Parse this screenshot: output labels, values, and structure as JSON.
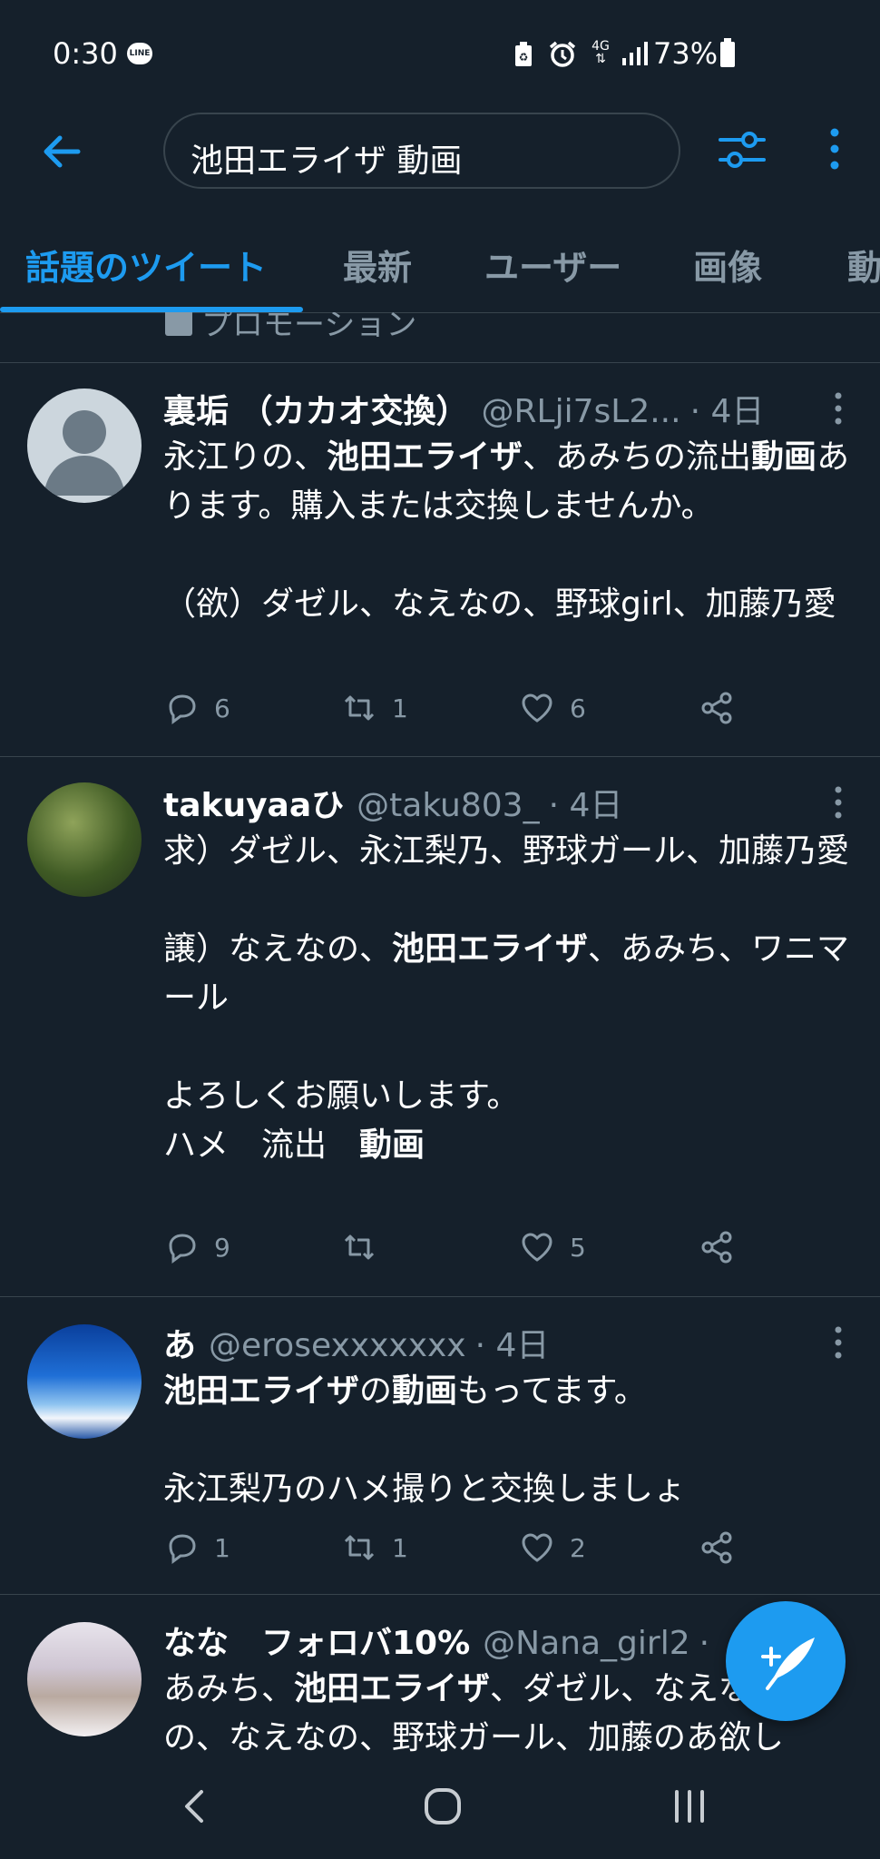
{
  "status": {
    "time": "0:30",
    "line_badge": "LINE",
    "network": "4G",
    "battery": "73%"
  },
  "header": {
    "search_query": "池田エライザ 動画"
  },
  "tabs": [
    "話題のツイート",
    "最新",
    "ユーザー",
    "画像",
    "動"
  ],
  "promo_label": "プロモーション",
  "tweets": [
    {
      "name": "裏垢 （カカオ交換）",
      "handle": "@RLji7sL2...",
      "time": "· 4日",
      "body": [
        {
          "text": "永江りの、",
          "bold": false
        },
        {
          "text": "池田エライザ",
          "bold": true
        },
        {
          "text": "、あみちの流出",
          "bold": false
        },
        {
          "text": "動画",
          "bold": true
        },
        {
          "text": "あります。購入または交換しませんか。\n\n（欲）ダゼル、なえなの、野球girl、加藤乃愛",
          "bold": false
        }
      ],
      "replies": "6",
      "retweets": "1",
      "likes": "6"
    },
    {
      "name": "takuyaaひ",
      "handle": "@taku803_",
      "time": "· 4日",
      "body": [
        {
          "text": "求）ダゼル、永江梨乃、野球ガール、加藤乃愛\n\n譲）なえなの、",
          "bold": false
        },
        {
          "text": "池田エライザ",
          "bold": true
        },
        {
          "text": "、あみち、ワニマール\n\nよろしくお願いします。\nハメ　流出　",
          "bold": false
        },
        {
          "text": "動画",
          "bold": true
        }
      ],
      "replies": "9",
      "retweets": "",
      "likes": "5"
    },
    {
      "name": "あ",
      "handle": "@erosexxxxxxx",
      "time": "· 4日",
      "body": [
        {
          "text": "池田エライザ",
          "bold": true
        },
        {
          "text": "の",
          "bold": false
        },
        {
          "text": "動画",
          "bold": true
        },
        {
          "text": "もってます。\n\n永江梨乃のハメ撮りと交換しましょ",
          "bold": false
        }
      ],
      "replies": "1",
      "retweets": "1",
      "likes": "2"
    },
    {
      "name": "なな　フォロバ10%",
      "handle": "@Nana_girl2",
      "time": "·",
      "body": [
        {
          "text": "あみち、",
          "bold": false
        },
        {
          "text": "池田エライザ",
          "bold": true
        },
        {
          "text": "、ダゼル、なえな\nの、なえなの、野球ガール、加藤のあ欲し",
          "bold": false
        }
      ],
      "replies": "",
      "retweets": "",
      "likes": ""
    }
  ],
  "colors": {
    "background": "#15202b",
    "accent": "#1d9bf0",
    "muted": "#8899a6",
    "divider": "#38444d"
  }
}
